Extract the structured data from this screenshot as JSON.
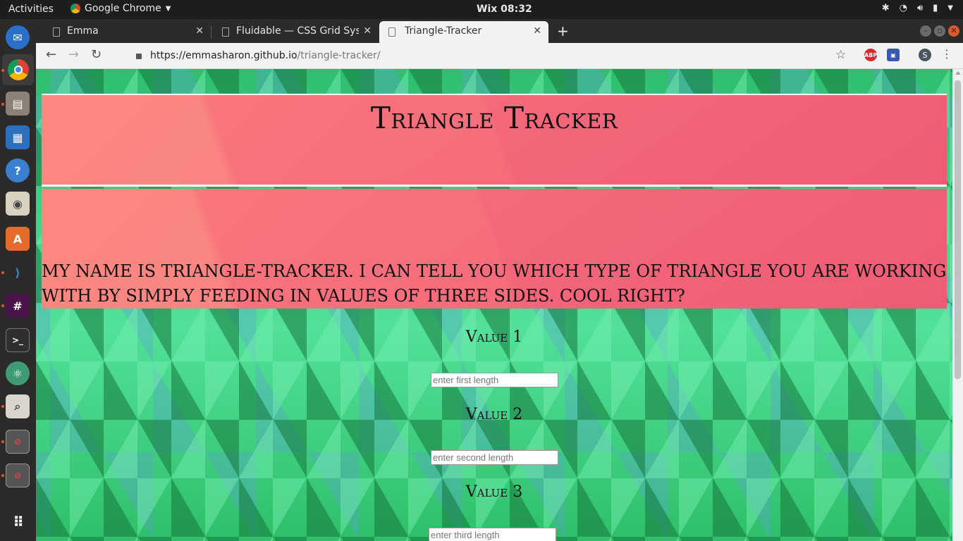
{
  "topbar": {
    "activities": "Activities",
    "app_name": "Google Chrome",
    "clock": "Wix 08:32"
  },
  "dock": {
    "items": [
      "thunderbird-icon",
      "chrome-icon",
      "files-icon",
      "writer-icon",
      "help-icon",
      "speaker-icon",
      "software-icon",
      "vscode-icon",
      "slack-icon",
      "terminal-icon",
      "atom-icon",
      "screenshot-icon",
      "drive-icon",
      "drive-icon",
      "apps-grid-icon"
    ]
  },
  "browser": {
    "tabs": [
      {
        "title": "Emma",
        "active": false
      },
      {
        "title": "Fluidable — CSS Grid Syst",
        "active": false
      },
      {
        "title": "Triangle-Tracker",
        "active": true
      }
    ],
    "url_host": "https://emmasharon.github.io",
    "url_path": "/triangle-tracker/",
    "profile_initial": "S",
    "abp_label": "ABP"
  },
  "page": {
    "title": "Triangle Tracker",
    "intro": "My name is Triangle-Tracker. I can tell you which type of triangle you are working with by simply feeding in values of three sides. Cool right?",
    "fields": [
      {
        "label": "Value 1",
        "placeholder": "enter first length"
      },
      {
        "label": "Value 2",
        "placeholder": "enter second length"
      },
      {
        "label": "Value 3",
        "placeholder": "enter third length"
      }
    ]
  },
  "colors": {
    "accent_orange": "#e95420",
    "header_pink": "#f66f7c",
    "background_green": "#3ccf7c"
  }
}
